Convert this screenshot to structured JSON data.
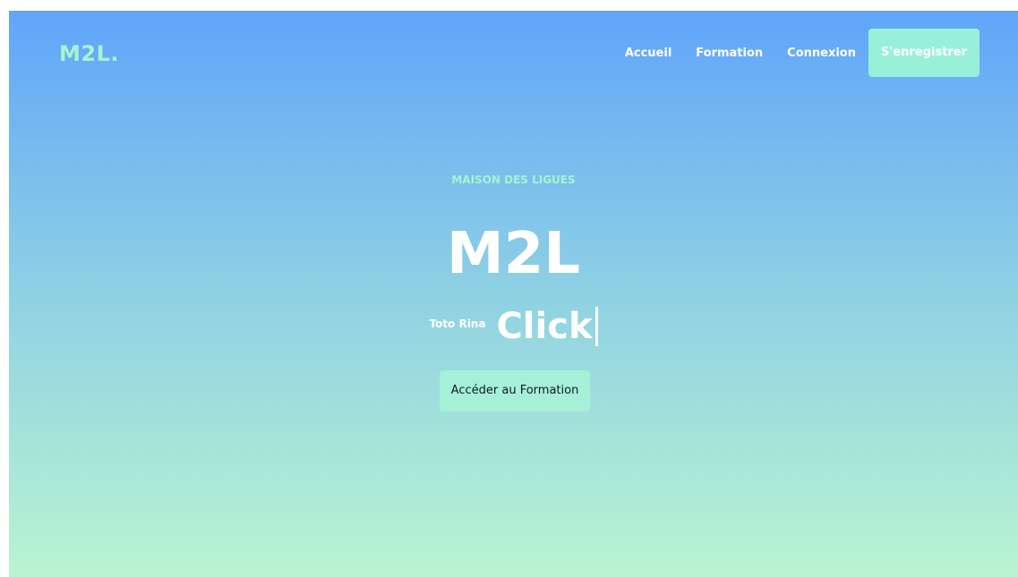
{
  "brand": {
    "logo": "M2L."
  },
  "nav": {
    "items": [
      {
        "label": "Accueil"
      },
      {
        "label": "Formation"
      },
      {
        "label": "Connexion"
      }
    ],
    "register_label": "S'enregistrer"
  },
  "hero": {
    "eyebrow": "MAISON DES LIGUES",
    "title": "M2L",
    "typing_prefix": "Toto Rina",
    "typing_word": "Click",
    "cta_label": "Accéder au Formation"
  },
  "colors": {
    "gradient_top": "#60a5fa",
    "gradient_bottom": "#b9f4d1",
    "accent": "#a7f3d0",
    "button": "#a7f0d8"
  }
}
